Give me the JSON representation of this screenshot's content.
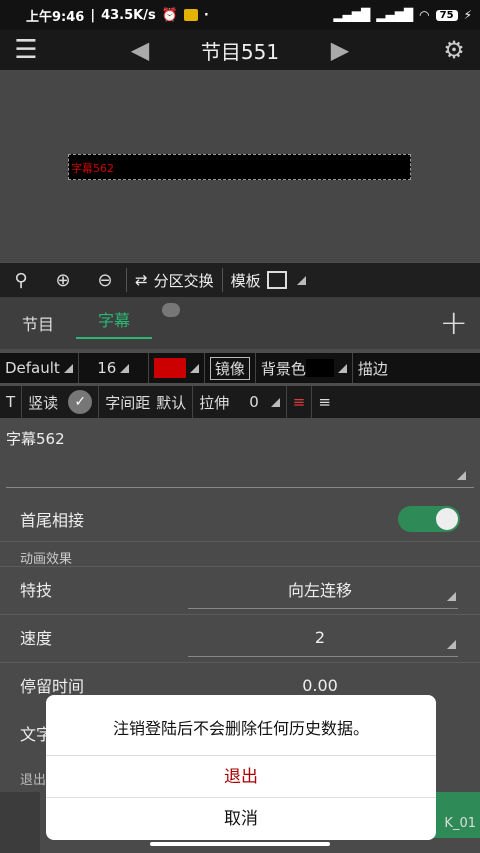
{
  "status": {
    "time": "上午9:46",
    "speed": "43.5K/s",
    "battery": "75"
  },
  "header": {
    "title": "节目551"
  },
  "preview": {
    "subtitle_text": "字幕562"
  },
  "zoombar": {
    "partition_label": "分区交换",
    "template_label": "模板"
  },
  "tabs": [
    {
      "label": "节目"
    },
    {
      "label": "字幕"
    }
  ],
  "fontbar": {
    "font": "Default",
    "size": "16",
    "mirror": "镜像",
    "bg_color": "背景色",
    "stroke": "描边",
    "text_color": "#cc0000"
  },
  "stylebar": {
    "t": "T",
    "vertical": "竖读",
    "spacing_label": "字间距",
    "spacing_value": "默认",
    "stretch_label": "拉伸",
    "stretch_value": "0"
  },
  "form": {
    "text_value": "字幕562",
    "head_tail_label": "首尾相接",
    "section_anim": "动画效果",
    "effect_label": "特技",
    "effect_value": "向左连移",
    "speed_label": "速度",
    "speed_value": "2",
    "stay_label": "停留时间",
    "stay_value": "0.00",
    "text_partial": "文字",
    "exit_partial": "退出"
  },
  "dialog": {
    "message": "注销登陆后不会删除任何历史数据。",
    "exit": "退出",
    "cancel": "取消"
  },
  "green_button": {
    "partial": "K_01"
  }
}
